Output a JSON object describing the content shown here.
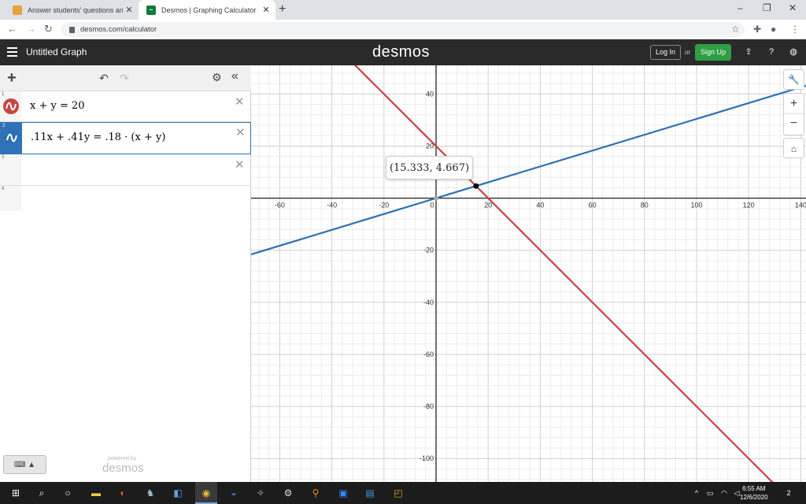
{
  "browser": {
    "tabs": [
      {
        "title": "Answer students' questions and",
        "active": false,
        "favicon_color": "#e8a33a"
      },
      {
        "title": "Desmos | Graphing Calculator",
        "active": true,
        "favicon_color": "#127a3a"
      }
    ],
    "url": "desmos.com/calculator"
  },
  "header": {
    "graph_title": "Untitled Graph",
    "logo": "desmos",
    "login_label": "Log In",
    "or_label": "or",
    "signup_label": "Sign Up"
  },
  "expressions": [
    {
      "num": "1",
      "latex": "x + y  =  20",
      "color": "#c74440"
    },
    {
      "num": "2",
      "latex": ".11x + .41y  =  .18 · (x + y)",
      "color": "#2d70b3"
    },
    {
      "num": "3",
      "latex": ""
    },
    {
      "num": "4",
      "latex": ""
    }
  ],
  "footer": {
    "powered_by": "powered by",
    "logo": "desmos"
  },
  "graph": {
    "x_ticks": [
      "-60",
      "-40",
      "-20",
      "0",
      "20",
      "40",
      "60",
      "80",
      "100",
      "120",
      "140"
    ],
    "y_ticks": [
      "40",
      "20",
      "-20",
      "-40",
      "-60",
      "-80",
      "-100"
    ],
    "intersection_label": "(15.333, 4.667)",
    "intersection": {
      "x": 15.333,
      "y": 4.667
    }
  },
  "chart_data": {
    "type": "line",
    "xlim": [
      -71,
      142
    ],
    "ylim": [
      -109,
      51
    ],
    "grid": true,
    "series": [
      {
        "equation": "x + y = 20",
        "color": "#c74440",
        "x": [
          -71,
          142
        ],
        "y": [
          91,
          -122
        ]
      },
      {
        "equation": ".11x + .41y = .18 · (x + y)",
        "color": "#2d70b3",
        "x": [
          -71,
          142
        ],
        "y": [
          -21.61,
          43.21
        ]
      }
    ],
    "points": [
      {
        "x": 15.333,
        "y": 4.667,
        "label": "(15.333, 4.667)"
      }
    ]
  },
  "taskbar": {
    "time": "6:55 AM",
    "date": "12/6/2020",
    "notifications": "2"
  }
}
